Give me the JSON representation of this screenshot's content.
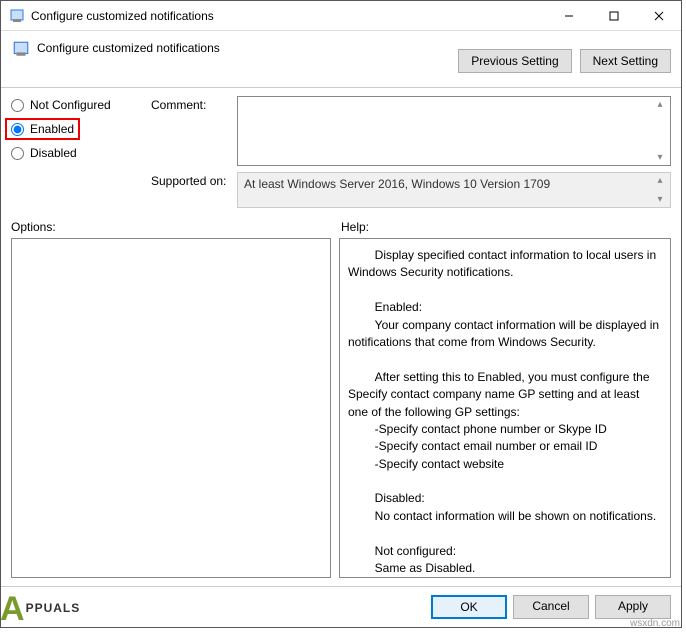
{
  "window": {
    "title": "Configure customized notifications"
  },
  "header": {
    "title": "Configure customized notifications",
    "prev": "Previous Setting",
    "next": "Next Setting"
  },
  "radios": {
    "not_configured": "Not Configured",
    "enabled": "Enabled",
    "disabled": "Disabled"
  },
  "fields": {
    "comment_label": "Comment:",
    "comment_value": "",
    "supported_label": "Supported on:",
    "supported_value": "At least Windows Server 2016, Windows 10 Version 1709"
  },
  "section": {
    "options": "Options:",
    "help": "Help:"
  },
  "help_text": "        Display specified contact information to local users in Windows Security notifications.\n\n        Enabled:\n        Your company contact information will be displayed in notifications that come from Windows Security.\n\n        After setting this to Enabled, you must configure the Specify contact company name GP setting and at least one of the following GP settings:\n        -Specify contact phone number or Skype ID\n        -Specify contact email number or email ID\n        -Specify contact website\n\n        Disabled:\n        No contact information will be shown on notifications.\n\n        Not configured:\n        Same as Disabled.",
  "footer": {
    "ok": "OK",
    "cancel": "Cancel",
    "apply": "Apply"
  },
  "watermark": {
    "brand": "PPUALS",
    "site": "wsxdn.com"
  }
}
